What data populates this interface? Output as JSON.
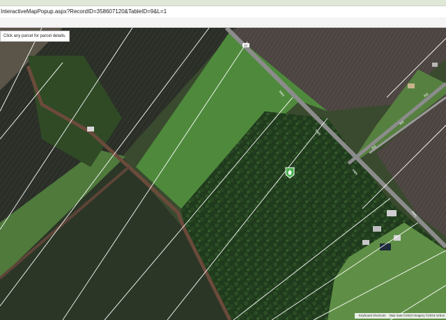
{
  "browser": {
    "url": "InteractiveMapPopup.aspx?RecordID=358607120&TableID=9&L=1"
  },
  "map": {
    "hint_text": "Click any parcel for parcel details.",
    "road_labels": {
      "main_road_1": "Hwy",
      "main_road_2": "Hwy",
      "main_road_3": "Hwy",
      "main_road_4": "Hwy",
      "side_road_1": "Rd",
      "side_road_2": "Rd",
      "side_road_3": "Rd",
      "badge": "20"
    },
    "marker_icon": "home-marker-icon",
    "attribution": {
      "shortcuts": "Keyboard shortcuts",
      "imagery": "Map data ©2023 Imagery ©2023 Airbus"
    }
  },
  "colors": {
    "marker": "#4caf50",
    "road": "#8c8c8c",
    "parcel_line": "#ffffff"
  }
}
